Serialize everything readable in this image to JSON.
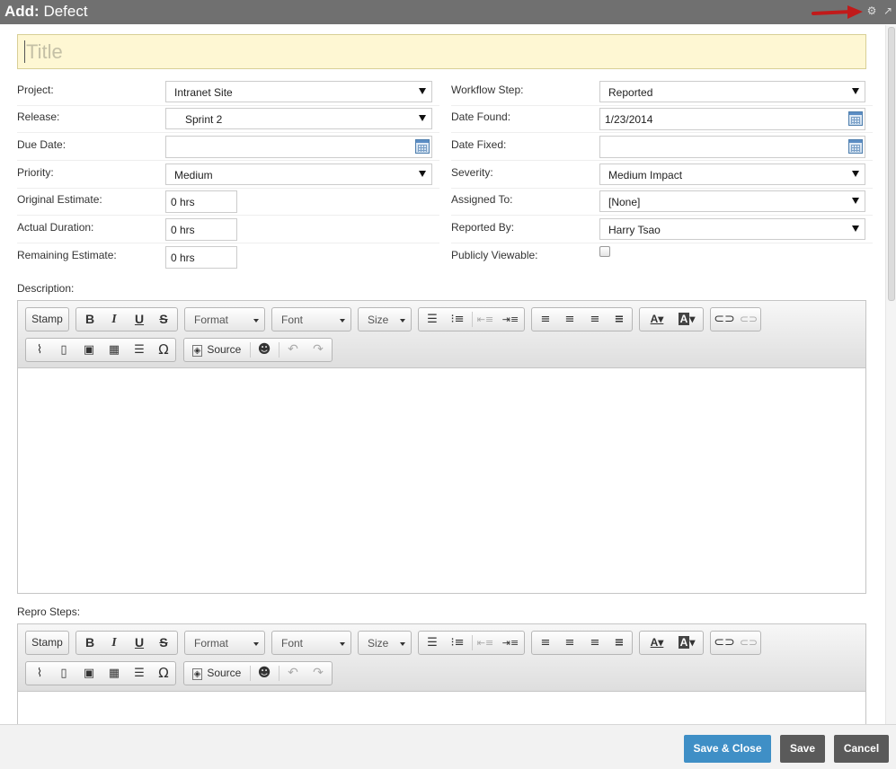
{
  "header": {
    "prefix": "Add:",
    "title": "Defect",
    "settings_icon": "gear-icon",
    "popout_icon": "popout-arrow-icon",
    "annotation_color": "#c11a1a"
  },
  "title_field": {
    "placeholder": "Title"
  },
  "left_fields": [
    {
      "label": "Project:",
      "value": "Intranet Site",
      "kind": "select"
    },
    {
      "label": "Release:",
      "value": "Sprint 2",
      "kind": "select"
    },
    {
      "label": "Due Date:",
      "value": "",
      "kind": "date"
    },
    {
      "label": "Priority:",
      "value": "Medium",
      "kind": "select"
    },
    {
      "label": "Original Estimate:",
      "value": "0 hrs",
      "kind": "text"
    },
    {
      "label": "Actual Duration:",
      "value": "0 hrs",
      "kind": "text"
    },
    {
      "label": "Remaining Estimate:",
      "value": "0 hrs",
      "kind": "text"
    }
  ],
  "right_fields": [
    {
      "label": "Workflow Step:",
      "value": "Reported",
      "kind": "select"
    },
    {
      "label": "Date Found:",
      "value": "1/23/2014",
      "kind": "date"
    },
    {
      "label": "Date Fixed:",
      "value": "",
      "kind": "date"
    },
    {
      "label": "Severity:",
      "value": "Medium Impact",
      "kind": "select"
    },
    {
      "label": "Assigned To:",
      "value": "[None]",
      "kind": "select"
    },
    {
      "label": "Reported By:",
      "value": "Harry Tsao",
      "kind": "select"
    },
    {
      "label": "Publicly Viewable:",
      "value": "",
      "kind": "checkbox"
    }
  ],
  "description": {
    "label": "Description:"
  },
  "repro": {
    "label": "Repro Steps:"
  },
  "toolbar": {
    "stamp": "Stamp",
    "bold": "B",
    "italic": "I",
    "underline": "U",
    "strike": "S",
    "format": "Format",
    "font": "Font",
    "size": "Size",
    "source": "Source",
    "omega": "Ω"
  },
  "footer": {
    "save_close": "Save & Close",
    "save": "Save",
    "cancel": "Cancel",
    "colors": {
      "save_close": "#3f8fc6",
      "save": "#5a5a5a",
      "cancel": "#5a5a5a"
    }
  }
}
